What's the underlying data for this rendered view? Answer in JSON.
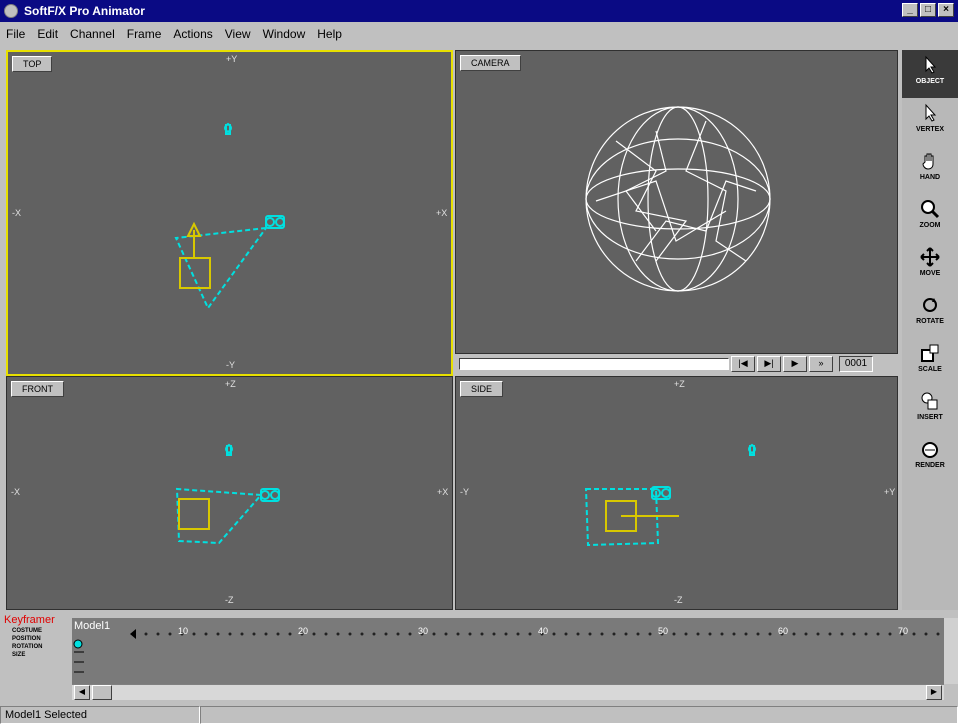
{
  "window": {
    "title": "SoftF/X Pro Animator"
  },
  "menu": [
    "File",
    "Edit",
    "Channel",
    "Frame",
    "Actions",
    "View",
    "Window",
    "Help"
  ],
  "viewports": {
    "top": {
      "label": "TOP",
      "axes": {
        "top": "+Y",
        "bottom": "-Y",
        "left": "-X",
        "right": "+X"
      }
    },
    "camera": {
      "label": "CAMERA"
    },
    "front": {
      "label": "FRONT",
      "axes": {
        "top": "+Z",
        "bottom": "-Z",
        "left": "-X",
        "right": "+X"
      }
    },
    "side": {
      "label": "SIDE",
      "axes": {
        "top": "+Z",
        "bottom": "-Z",
        "left": "-Y",
        "right": "+Y"
      }
    }
  },
  "playback": {
    "frame": "0001"
  },
  "tools": [
    "OBJECT",
    "VERTEX",
    "HAND",
    "ZOOM",
    "MOVE",
    "ROTATE",
    "SCALE",
    "INSERT",
    "RENDER"
  ],
  "keyframer": {
    "title": "Keyframer",
    "channels": [
      "COSTUME",
      "POSITION",
      "ROTATION",
      "SIZE"
    ],
    "model": "Model1",
    "ticks": [
      "10",
      "20",
      "30",
      "40",
      "50",
      "60",
      "70"
    ]
  },
  "status": {
    "message": "Model1 Selected"
  },
  "colors": {
    "viewport_bg": "#616161",
    "cyan": "#00e0e0",
    "yellow": "#d8c800",
    "active_border": "#e8e000"
  }
}
